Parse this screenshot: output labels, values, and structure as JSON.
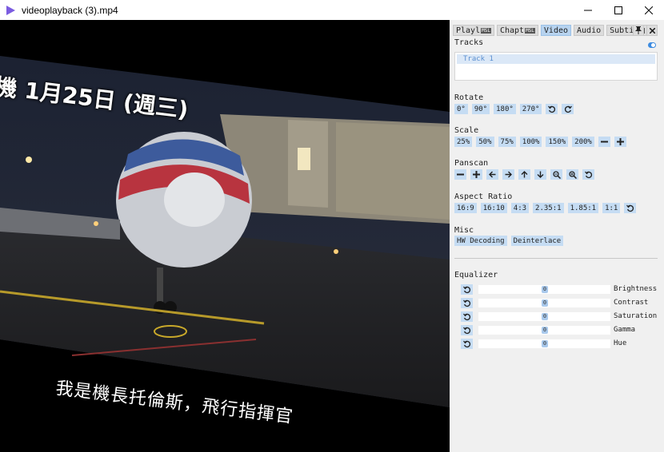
{
  "window": {
    "title": "videoplayback (3).mp4"
  },
  "video": {
    "subtitle_top": "機  1月25日 (週三)",
    "subtitle_bottom": "我是機長托倫斯，飛行指揮官"
  },
  "panel": {
    "tabs": [
      {
        "label": "Playl",
        "has_badge": true
      },
      {
        "label": "Chapt",
        "has_badge": true
      },
      {
        "label": "Video",
        "has_badge": false,
        "active": true
      },
      {
        "label": "Audio",
        "has_badge": false
      },
      {
        "label": "Subti",
        "has_badge": true
      }
    ],
    "tab_badge": "MSL",
    "tracks": {
      "label": "Tracks",
      "items": [
        "Track 1"
      ],
      "enabled": true
    },
    "rotate": {
      "label": "Rotate",
      "buttons": [
        "0°",
        "90°",
        "180°",
        "270°"
      ]
    },
    "scale": {
      "label": "Scale",
      "buttons": [
        "25%",
        "50%",
        "75%",
        "100%",
        "150%",
        "200%"
      ]
    },
    "panscan": {
      "label": "Panscan"
    },
    "aspect": {
      "label": "Aspect Ratio",
      "buttons": [
        "16:9",
        "16:10",
        "4:3",
        "2.35:1",
        "1.85:1",
        "1:1"
      ]
    },
    "misc": {
      "label": "Misc",
      "buttons": [
        "HW Decoding",
        "Deinterlace"
      ]
    },
    "equalizer": {
      "label": "Equalizer",
      "rows": [
        {
          "name": "Brightness",
          "value": "0"
        },
        {
          "name": "Contrast",
          "value": "0"
        },
        {
          "name": "Saturation",
          "value": "0"
        },
        {
          "name": "Gamma",
          "value": "0"
        },
        {
          "name": "Hue",
          "value": "0"
        }
      ]
    }
  },
  "colors": {
    "accent": "#3c8be0",
    "button_bg": "#c5dcf3",
    "panel_bg": "#f0f0f0",
    "app_icon": "#7b5ce0"
  }
}
